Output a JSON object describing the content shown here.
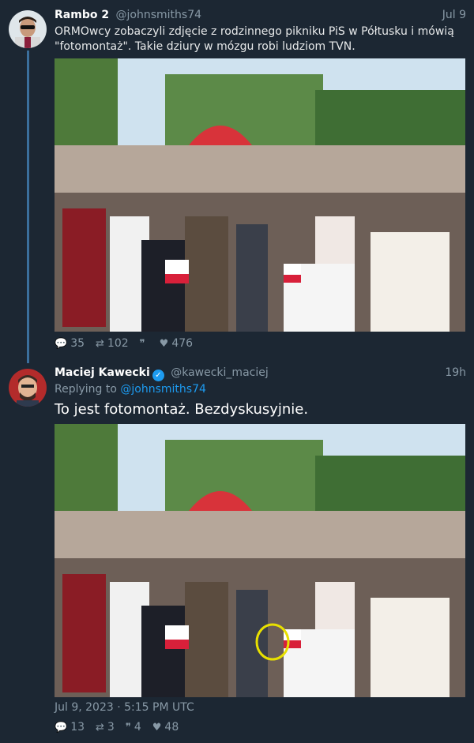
{
  "tweets": [
    {
      "display_name": "Rambo 2",
      "handle": "@johnsmiths74",
      "time": "Jul 9",
      "text": "ORMOwcy zobaczyli zdjęcie z rodzinnego pikniku PiS w Półtusku i mówią \"fotomontaż\". Takie dziury w mózgu robi ludziom TVN.",
      "actions": {
        "replies": "35",
        "retweets": "102",
        "quotes": "",
        "likes": "476"
      }
    },
    {
      "display_name": "Maciej Kawecki",
      "handle": "@kawecki_maciej",
      "time": "19h",
      "replying_prefix": "Replying to ",
      "replying_to": "@johnsmiths74",
      "text": "To jest fotomontaż. Bezdyskusyjnie.",
      "timestamp": "Jul 9, 2023 · 5:15 PM UTC",
      "actions": {
        "replies": "13",
        "retweets": "3",
        "quotes": "4",
        "likes": "48"
      }
    }
  ],
  "icons": {
    "reply": "reply-icon",
    "retweet": "retweet-icon",
    "quote": "quote-icon",
    "like": "heart-icon",
    "verified": "verified-badge-icon"
  },
  "colors": {
    "background": "#1c2733",
    "secondary_text": "#8899a6",
    "link": "#1d9bf0",
    "thread_line": "#3b6f9c",
    "highlight_circle": "#e8e000"
  }
}
